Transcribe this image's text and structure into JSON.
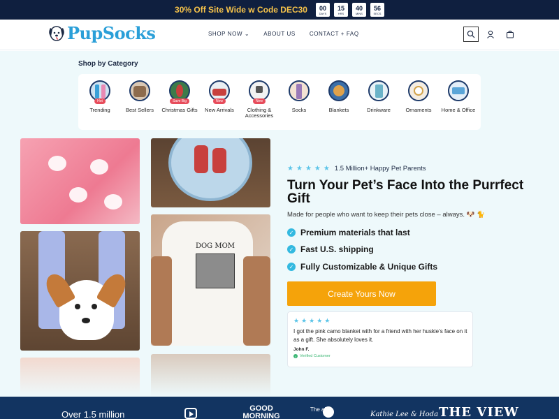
{
  "announcement": {
    "text": "30% Off Site Wide w Code DEC30",
    "countdown": [
      {
        "value": "00",
        "unit": "DAYS"
      },
      {
        "value": "15",
        "unit": "HRS"
      },
      {
        "value": "40",
        "unit": "MINS"
      },
      {
        "value": "56",
        "unit": "SECS"
      }
    ]
  },
  "header": {
    "logo": "PupSocks",
    "nav": [
      "SHOP NOW",
      "ABOUT US",
      "CONTACT + FAQ"
    ],
    "icons": [
      "search-icon",
      "account-icon",
      "cart-icon"
    ]
  },
  "categories": {
    "title": "Shop by Category",
    "items": [
      {
        "label": "Trending",
        "badge": "Hot"
      },
      {
        "label": "Best Sellers",
        "badge": ""
      },
      {
        "label": "Christmas Gifts",
        "badge": "Save Big"
      },
      {
        "label": "New Arrivals",
        "badge": "New"
      },
      {
        "label": "Clothing & Accessories",
        "badge": "New"
      },
      {
        "label": "Socks",
        "badge": ""
      },
      {
        "label": "Blankets",
        "badge": ""
      },
      {
        "label": "Drinkware",
        "badge": ""
      },
      {
        "label": "Ornaments",
        "badge": ""
      },
      {
        "label": "Home & Office",
        "badge": ""
      }
    ]
  },
  "hero": {
    "rating_text": "1.5 Million+ Happy Pet Parents",
    "headline": "Turn Your Pet’s Face Into the Purrfect Gift",
    "subline": "Made for people who want to keep their pets close – always. 🐶 🐈",
    "features": [
      "Premium materials that last",
      "Fast U.S. shipping",
      "Fully Customizable & Unique Gifts"
    ],
    "cta": "Create Yours Now",
    "shirt_text": "DOG MOM",
    "review": {
      "text": "I got the pink camo blanket with for a friend with her huskie’s face on it as a gift. She absolutely loves it.",
      "name": "John F.",
      "verified": "Verified Customer"
    }
  },
  "press": {
    "intro": "Over 1.5 million",
    "logos": [
      "GOOD MORNING",
      "The abc",
      "Kathie Lee & Hoda",
      "THE VIEW"
    ]
  },
  "colors": {
    "navy": "#0f1f3f",
    "accent_yellow": "#f6c34a",
    "brand_blue": "#2a9fd8",
    "cta_orange": "#f5a30a",
    "check_blue": "#33b9e0",
    "page_bg": "#eef9fb"
  }
}
